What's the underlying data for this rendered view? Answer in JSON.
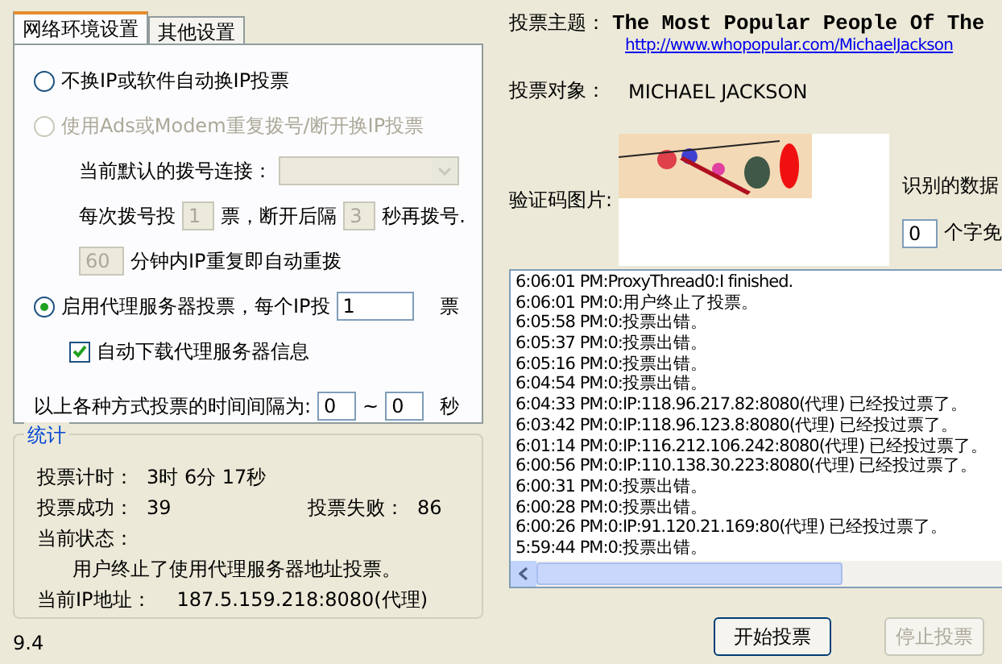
{
  "tabs": [
    {
      "label": "网络环境设置",
      "selected": true
    },
    {
      "label": "其他设置",
      "selected": false
    }
  ],
  "ip_modes": [
    {
      "label": "不换IP或软件自动换IP投票",
      "selected": false,
      "disabled": false
    },
    {
      "label": "使用Ads或Modem重复拨号/断开换IP投票",
      "selected": false,
      "disabled": true
    },
    {
      "label": "启用代理服务器投票，每个IP投",
      "selected": true,
      "disabled": false
    }
  ],
  "dial": {
    "disabled": true,
    "connection_label": "当前默认的拨号连接：",
    "votes_label": "每次拨号投",
    "votes_value": "1",
    "votes_suffix": "票，断开后隔",
    "wait_value": "3",
    "wait_suffix": "秒再拨号.",
    "redial_value": "60",
    "redial_suffix": "分钟内IP重复即自动重拨"
  },
  "proxy": {
    "votes_value": "1",
    "votes_suffix": "票",
    "auto_download": {
      "label": "自动下载代理服务器信息",
      "checked": true
    }
  },
  "interval": {
    "label": "以上各种方式投票的时间间隔为:",
    "from": "0",
    "separator": "~",
    "to": "0",
    "unit": "秒"
  },
  "stats": {
    "title": "统计",
    "timer_label": "投票计时：",
    "timer": "3时 6分 17秒",
    "success_label": "投票成功：",
    "success": "39",
    "fail_label": "投票失败：",
    "fail": "86",
    "status_label": "当前状态：",
    "status": "用户终止了使用代理服务器地址投票。",
    "ip_label": "当前IP地址：",
    "ip": "187.5.159.218:8080(代理)"
  },
  "version": "9.4",
  "topic": {
    "label": "投票主题：",
    "title": "The Most Popular People Of The",
    "link": "http://www.whopopular.com/MichaelJackson"
  },
  "target": {
    "label": "投票对象：",
    "value": "MICHAEL JACKSON"
  },
  "captcha": {
    "label": "验证码图片:",
    "kind": "picture",
    "recognized_label": "识别的数据",
    "count_value": "0",
    "count_suffix": "个字免"
  },
  "log": [
    "6:06:01 PM:ProxyThread0:I finished.",
    "6:06:01 PM:0:用户终止了投票。",
    "6:05:58 PM:0:投票出错。",
    "6:05:37 PM:0:投票出错。",
    "6:05:16 PM:0:投票出错。",
    "6:04:54 PM:0:投票出错。",
    "6:04:33 PM:0:IP:118.96.217.82:8080(代理) 已经投过票了。",
    "6:03:42 PM:0:IP:118.96.123.8:8080(代理) 已经投过票了。",
    "6:01:14 PM:0:IP:116.212.106.242:8080(代理) 已经投过票了。",
    "6:00:56 PM:0:IP:110.138.30.223:8080(代理) 已经投过票了。",
    "6:00:31 PM:0:投票出错。",
    "6:00:28 PM:0:投票出错。",
    "6:00:26 PM:0:IP:91.120.21.169:80(代理) 已经投过票了。",
    "5:59:44 PM:0:投票出错。"
  ],
  "buttons": [
    {
      "label": "开始投票",
      "disabled": false
    },
    {
      "label": "停止投票",
      "disabled": true
    }
  ]
}
